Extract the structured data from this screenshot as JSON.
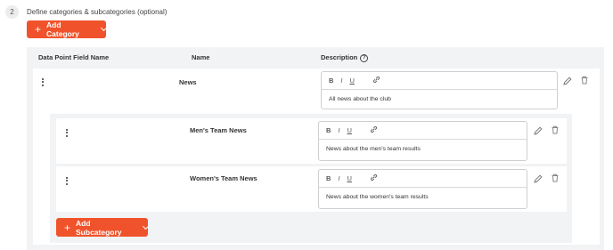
{
  "step": {
    "number": "2",
    "title": "Define categories & subcategories (optional)"
  },
  "add_category_button": {
    "label": "Add Category"
  },
  "table_header": {
    "field_name": "Data Point Field Name",
    "name": "Name",
    "description": "Description"
  },
  "toolbar": {
    "bold": "B",
    "italic": "I",
    "underline": "U"
  },
  "category": {
    "name": "News",
    "description": "All news about the club"
  },
  "subcategories": [
    {
      "name": "Men's Team News",
      "description": "News about the men's team results"
    },
    {
      "name": "Women's Team News",
      "description": "News about the women's team results"
    }
  ],
  "add_subcategory_button": {
    "label": "Add Subcategory"
  },
  "icons": {
    "add": "plus-icon",
    "dropdown": "chevron-down-icon",
    "help": "question-circle-icon",
    "drag": "kebab-icon",
    "link": "link-icon",
    "edit": "pencil-icon",
    "delete": "trash-icon"
  },
  "colors": {
    "accent": "#f0532b",
    "panel": "#f2f3f5"
  }
}
